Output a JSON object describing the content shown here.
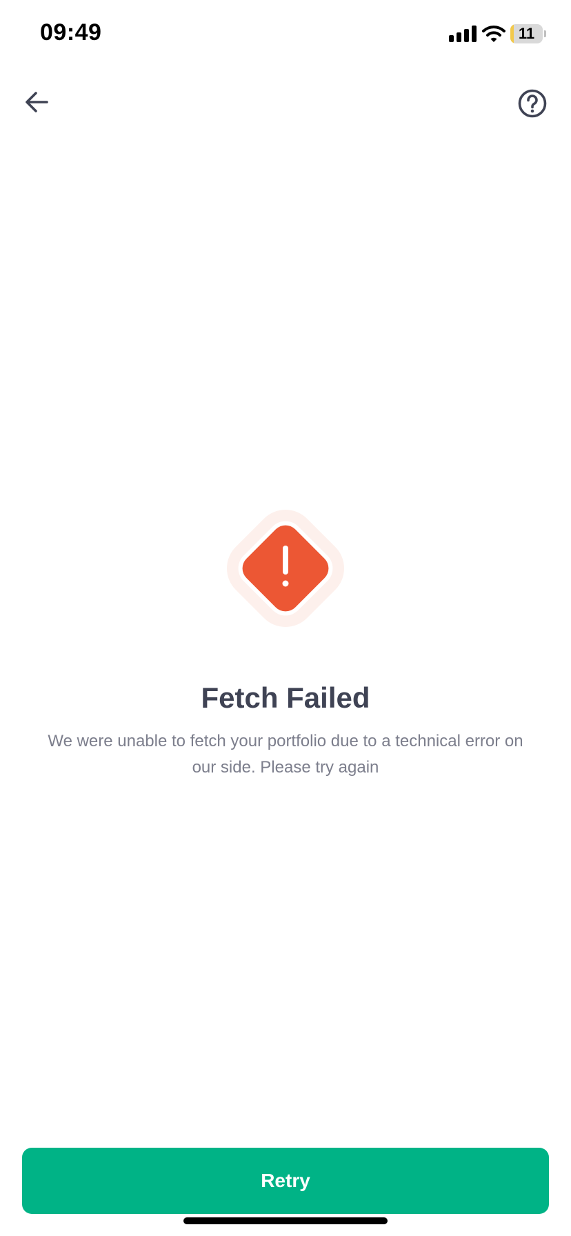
{
  "status_bar": {
    "time": "09:49",
    "battery_level": "11",
    "battery_fraction": 0.11,
    "icons": [
      "signal-icon",
      "wifi-icon",
      "battery-icon"
    ]
  },
  "header": {
    "back_icon": "arrow-left-icon",
    "help_icon": "question-circle-icon"
  },
  "error": {
    "icon": "exclamation-diamond-icon",
    "title": "Fetch Failed",
    "message": "We were unable to fetch your portfolio due to a technical error on our side. Please try again"
  },
  "actions": {
    "retry_label": "Retry"
  },
  "colors": {
    "accent": "#00b386",
    "error": "#ec5734",
    "error_halo": "#fdf0ec",
    "title": "#3f4354",
    "body_text": "#7c7e8c",
    "battery_fill": "#f2c94c"
  }
}
